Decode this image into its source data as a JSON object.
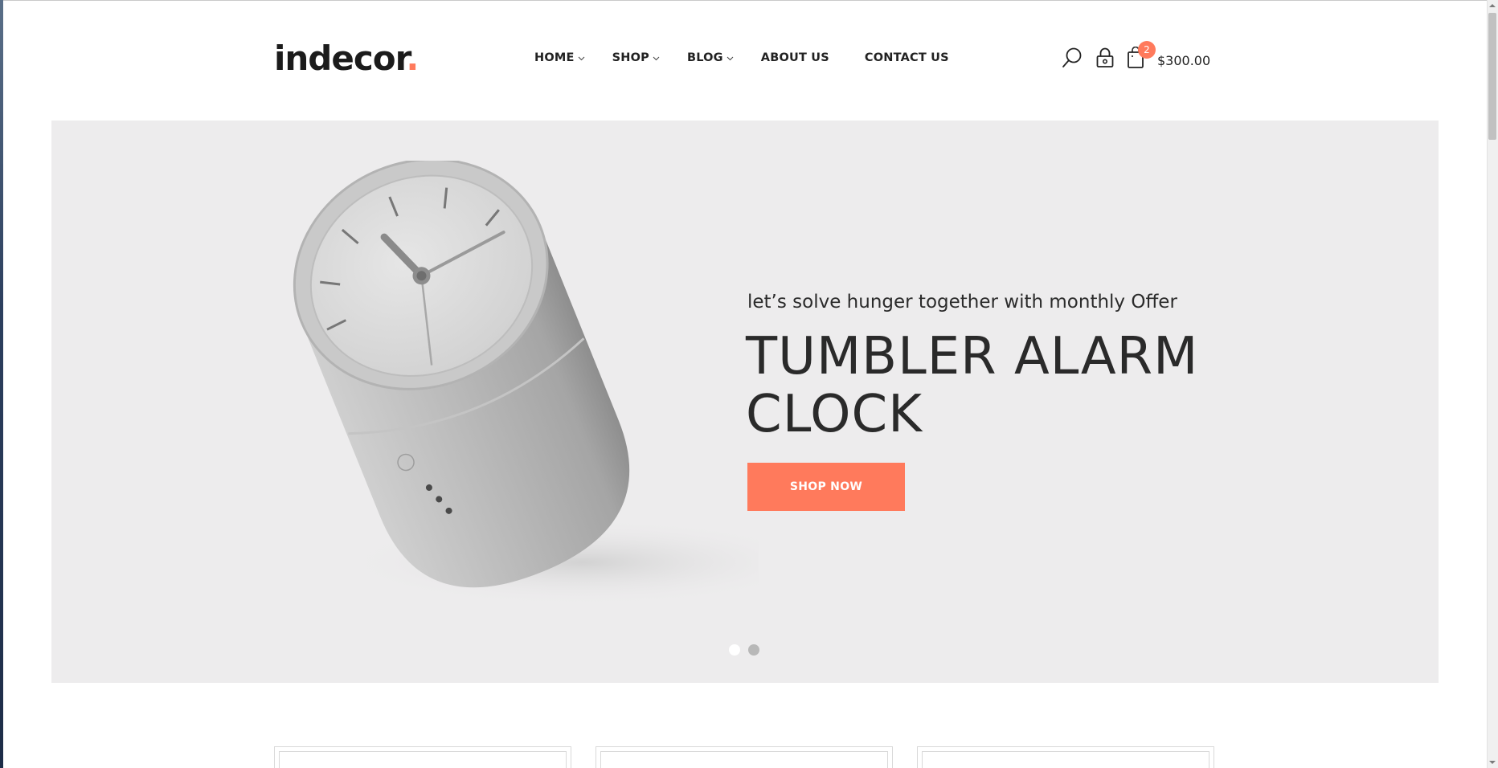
{
  "brand": {
    "name": "indecor",
    "dot": ".",
    "accent_color": "#ff7a5c"
  },
  "nav": {
    "items": [
      {
        "label": "HOME",
        "has_dropdown": true
      },
      {
        "label": "SHOP",
        "has_dropdown": true
      },
      {
        "label": "BLOG",
        "has_dropdown": true
      },
      {
        "label": "ABOUT US",
        "has_dropdown": false
      },
      {
        "label": "CONTACT US",
        "has_dropdown": false
      }
    ]
  },
  "header_icons": {
    "search": "search-icon",
    "account": "lock-icon",
    "cart": "shopping-bag-icon",
    "cart_count": "2",
    "cart_total": "$300.00"
  },
  "hero": {
    "subtitle": "let’s solve hunger together with monthly Offer",
    "title_line1": "TUMBLER ALARM",
    "title_line2": "CLOCK",
    "button_label": "SHOP NOW",
    "background": "#edeced",
    "slider": {
      "total": 2,
      "active": 1
    }
  },
  "colors": {
    "accent": "#ff7a5c",
    "text": "#222222"
  }
}
